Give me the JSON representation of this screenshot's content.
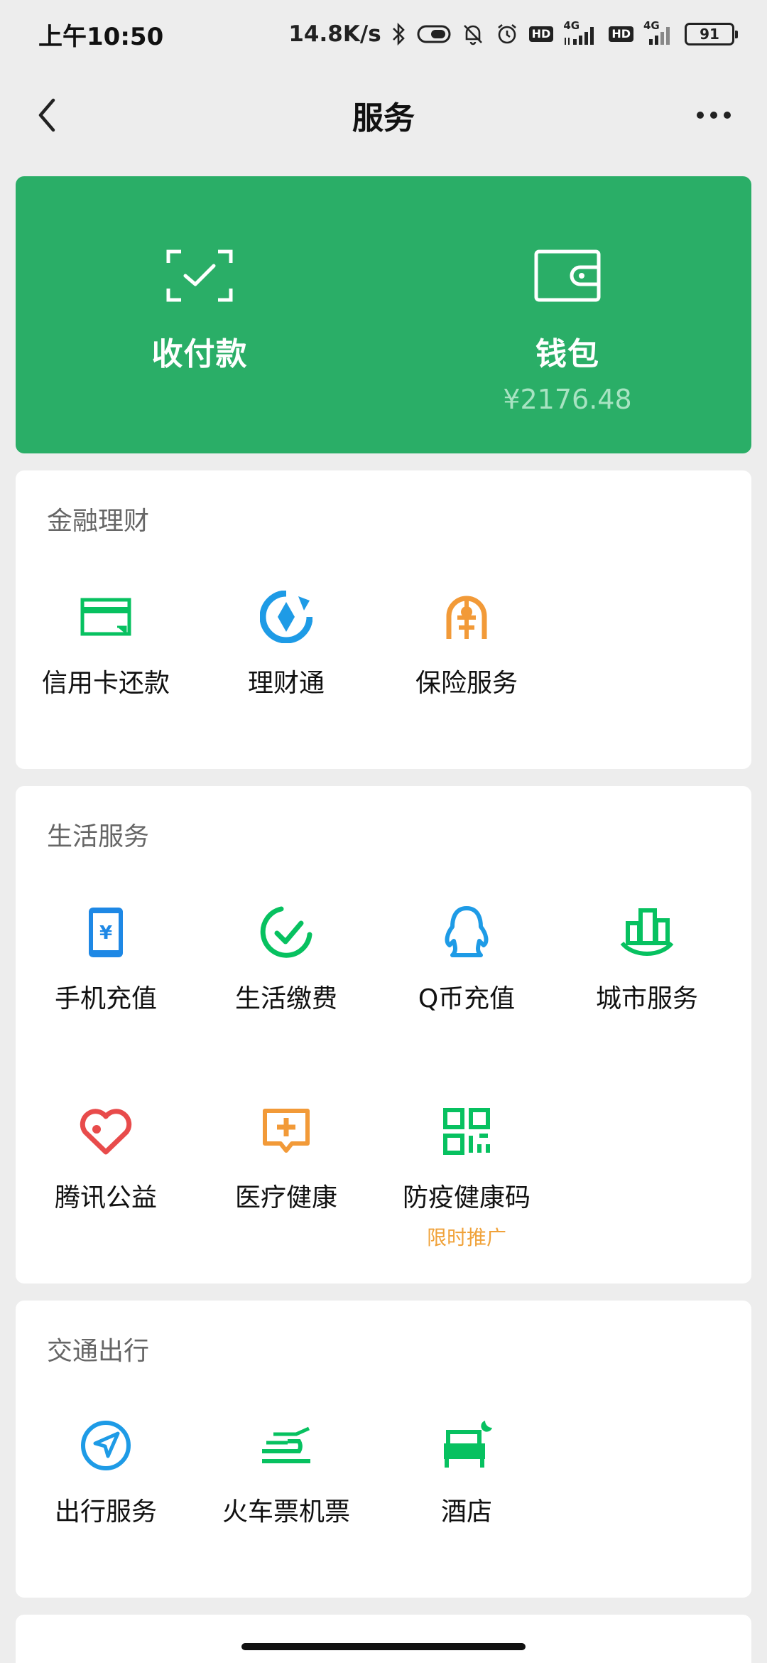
{
  "status": {
    "time": "上午10:50",
    "speed": "14.8K/s",
    "hd1": "HD",
    "net1": "4G",
    "hd2": "HD",
    "net2": "4G",
    "battery": "91"
  },
  "nav": {
    "title": "服务"
  },
  "hero": {
    "pay_label": "收付款",
    "wallet_label": "钱包",
    "wallet_balance": "¥2176.48"
  },
  "finance": {
    "title": "金融理财",
    "items": [
      {
        "label": "信用卡还款",
        "icon": "credit-card-icon",
        "color": "#07c160"
      },
      {
        "label": "理财通",
        "icon": "wealth-icon",
        "color": "#1e9be6"
      },
      {
        "label": "保险服务",
        "icon": "insurance-icon",
        "color": "#f29a38"
      }
    ]
  },
  "life": {
    "title": "生活服务",
    "items": [
      {
        "label": "手机充值",
        "icon": "phone-topup-icon",
        "color": "#1e88e5"
      },
      {
        "label": "生活缴费",
        "icon": "utility-payment-icon",
        "color": "#07c160"
      },
      {
        "label": "Q币充值",
        "icon": "qq-penguin-icon",
        "color": "#1e9be6"
      },
      {
        "label": "城市服务",
        "icon": "city-buildings-icon",
        "color": "#07c160"
      },
      {
        "label": "腾讯公益",
        "icon": "charity-heart-icon",
        "color": "#e84b4b"
      },
      {
        "label": "医疗健康",
        "icon": "medical-cross-icon",
        "color": "#f29a38"
      },
      {
        "label": "防疫健康码",
        "icon": "qr-code-icon",
        "color": "#07c160",
        "tag": "限时推广"
      }
    ]
  },
  "transport": {
    "title": "交通出行",
    "items": [
      {
        "label": "出行服务",
        "icon": "navigation-icon",
        "color": "#1e9be6"
      },
      {
        "label": "火车票机票",
        "icon": "train-plane-icon",
        "color": "#07c160"
      },
      {
        "label": "酒店",
        "icon": "hotel-bed-icon",
        "color": "#07c160"
      }
    ]
  }
}
